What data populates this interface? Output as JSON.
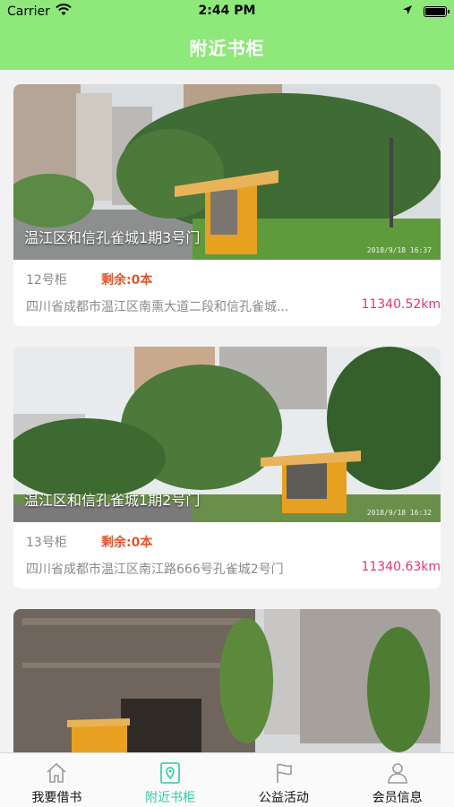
{
  "status": {
    "carrier": "Carrier",
    "time": "2:44 PM"
  },
  "header": {
    "title": "附近书柜"
  },
  "cards": [
    {
      "title": "温江区和信孔雀城1期3号门",
      "stamp": "2018/9/18  16:37",
      "cabinet": "12号柜",
      "remain": "剩余:0本",
      "address": "四川省成都市温江区南熏大道二段和信孔雀城...",
      "distance": "11340.52km"
    },
    {
      "title": "温江区和信孔雀城1期2号门",
      "stamp": "2018/9/18  16:32",
      "cabinet": "13号柜",
      "remain": "剩余:0本",
      "address": "四川省成都市温江区南江路666号孔雀城2号门",
      "distance": "11340.63km"
    },
    {
      "title": "",
      "stamp": "",
      "cabinet": "",
      "remain": "",
      "address": "",
      "distance": ""
    }
  ],
  "tabs": [
    {
      "label": "我要借书",
      "icon": "home-icon",
      "active": false
    },
    {
      "label": "附近书柜",
      "icon": "map-pin-icon",
      "active": true
    },
    {
      "label": "公益活动",
      "icon": "flag-icon",
      "active": false
    },
    {
      "label": "会员信息",
      "icon": "person-icon",
      "active": false
    }
  ],
  "colors": {
    "accent": "#8ee87a",
    "active_tab": "#2fc9a6",
    "remain": "#e2572f",
    "distance": "#e8326e"
  }
}
